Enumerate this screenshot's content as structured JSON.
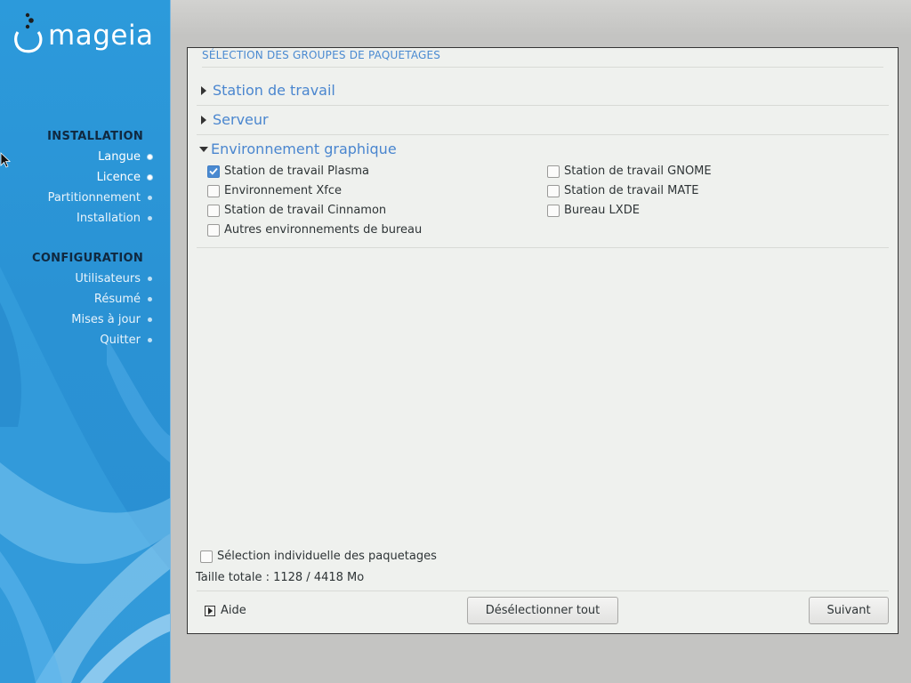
{
  "brand": {
    "logo_text": "mageia"
  },
  "sidebar": {
    "installation": {
      "heading": "INSTALLATION",
      "items": [
        {
          "label": "Langue",
          "state": "done"
        },
        {
          "label": "Licence",
          "state": "done"
        },
        {
          "label": "Partitionnement",
          "state": "pending"
        },
        {
          "label": "Installation",
          "state": "current"
        }
      ]
    },
    "configuration": {
      "heading": "CONFIGURATION",
      "items": [
        {
          "label": "Utilisateurs",
          "state": "pending"
        },
        {
          "label": "Résumé",
          "state": "pending"
        },
        {
          "label": "Mises à jour",
          "state": "pending"
        },
        {
          "label": "Quitter",
          "state": "pending"
        }
      ]
    }
  },
  "panel": {
    "title": "SÉLECTION DES GROUPES DE PAQUETAGES",
    "groups": [
      {
        "label": "Station de travail",
        "expanded": false
      },
      {
        "label": "Serveur",
        "expanded": false
      },
      {
        "label": "Environnement graphique",
        "expanded": true
      }
    ],
    "options": [
      {
        "label": "Station de travail Plasma",
        "checked": true
      },
      {
        "label": "Station de travail GNOME",
        "checked": false
      },
      {
        "label": "Environnement Xfce",
        "checked": false
      },
      {
        "label": "Station de travail MATE",
        "checked": false
      },
      {
        "label": "Station de travail Cinnamon",
        "checked": false
      },
      {
        "label": "Bureau LXDE",
        "checked": false
      },
      {
        "label": "Autres environnements de bureau",
        "checked": false
      }
    ],
    "individual_selection": {
      "label": "Sélection individuelle des paquetages",
      "checked": false
    },
    "total_size": "Taille totale : 1128 / 4418 Mo"
  },
  "buttons": {
    "help": "Aide",
    "deselect_all": "Désélectionner tout",
    "next": "Suivant"
  },
  "colors": {
    "accent": "#4a8ad1",
    "sidebar": "#2c9adb",
    "panel_bg": "#eff1ee",
    "desktop_bg": "#c4c4c2"
  }
}
